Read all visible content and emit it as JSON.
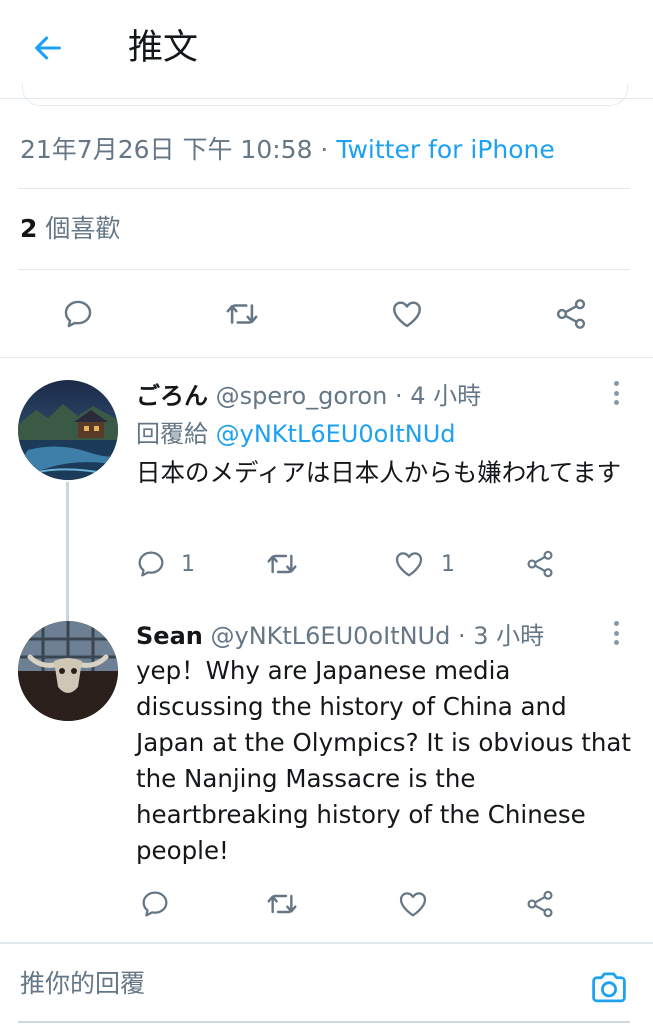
{
  "header": {
    "title": "推文",
    "back_icon": "arrow-left-icon"
  },
  "tweet_meta": {
    "datetime": "21年7月26日 下午 10:58",
    "separator": " · ",
    "source": "Twitter for iPhone"
  },
  "stats": {
    "likes_count": "2",
    "likes_label": " 個喜歡"
  },
  "replies": [
    {
      "name": "ごろん",
      "handle": "@spero_goron",
      "time": " · 4 小時",
      "reply_prefix": "回覆給 ",
      "reply_to": "@yNKtL6EU0oItNUd",
      "text": "日本のメディアは日本人からも嫌われてます",
      "reply_count": "1",
      "like_count": "1"
    },
    {
      "name": "Sean",
      "handle": "@yNKtL6EU0oItNUd",
      "time": " · 3 小時",
      "text": "yep！Why are Japanese media discussing the history of China and Japan at the Olympics? It is obvious that the Nanjing Massacre is the heartbreaking history of the Chinese people!"
    }
  ],
  "reply_input": {
    "placeholder": "推你的回覆"
  },
  "colors": {
    "accent": "#1da1f2",
    "secondary_text": "#657786",
    "icon_gray": "#657786",
    "divider": "#e1e8ed"
  }
}
